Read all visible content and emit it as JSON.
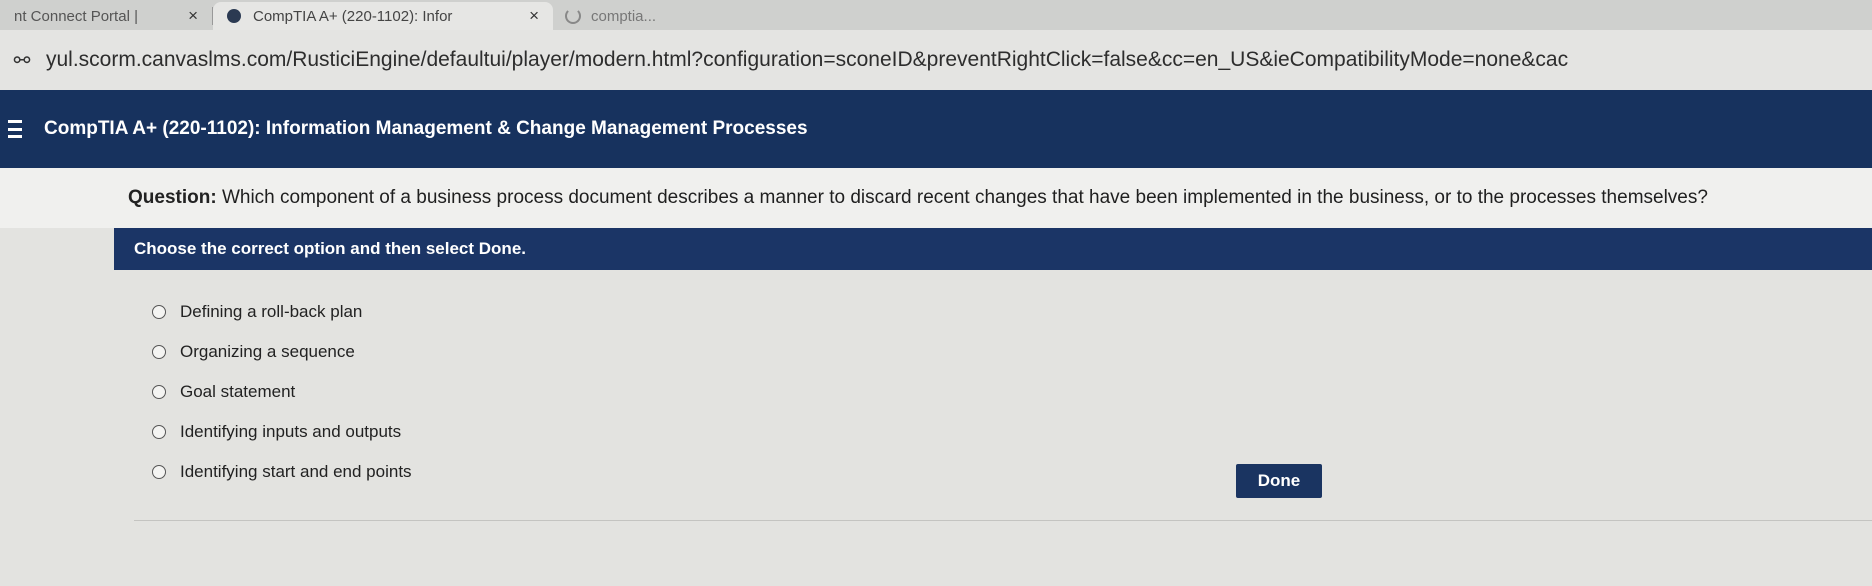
{
  "browser": {
    "tabs": [
      {
        "title": "nt Connect Portal | ",
        "close": "×",
        "active": false
      },
      {
        "title": "CompTIA A+ (220-1102): Infor",
        "close": "×",
        "active": true
      }
    ],
    "extra_tab_text": "comptia...",
    "url": "yul.scorm.canvaslms.com/RusticiEngine/defaultui/player/modern.html?configuration=sconeID&preventRightClick=false&cc=en_US&ieCompatibilityMode=none&cac"
  },
  "course": {
    "title": "CompTIA A+ (220-1102): Information Management & Change Management Processes"
  },
  "question": {
    "prefix": "Question:",
    "text": "Which component of a business process document describes a manner to discard recent changes that have been implemented in the business, or to the processes themselves?"
  },
  "instruction": "Choose the correct option and then select Done.",
  "options": [
    {
      "label": "Defining a roll-back plan"
    },
    {
      "label": "Organizing a sequence"
    },
    {
      "label": "Goal statement"
    },
    {
      "label": "Identifying inputs and outputs"
    },
    {
      "label": "Identifying start and end points"
    }
  ],
  "done_label": "Done",
  "icons": {
    "site_info": "site-info-icon",
    "menu": "hamburger-icon",
    "radio": "radio-icon"
  }
}
